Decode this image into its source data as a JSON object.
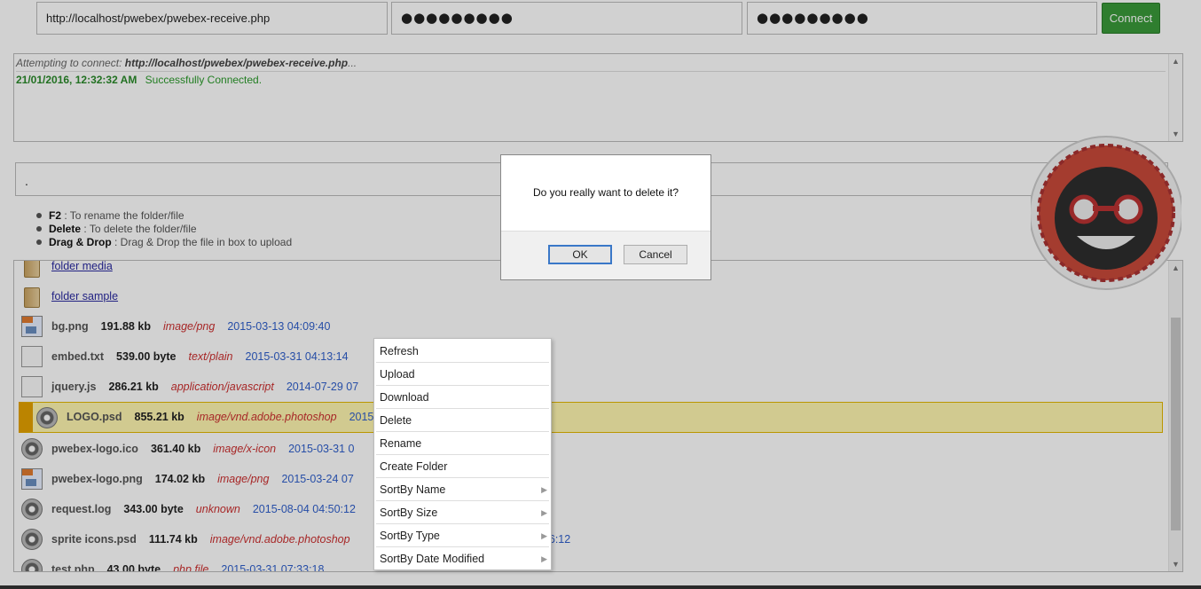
{
  "connection": {
    "url": "http://localhost/pwebex/pwebex-receive.php",
    "username_masked": "●●●●●●●●●",
    "password_masked": "●●●●●●●●●",
    "connect_label": "Connect"
  },
  "log": {
    "attempt_prefix": "Attempting to connect: ",
    "attempt_url": "http://localhost/pwebex/pwebex-receive.php",
    "attempt_suffix": "...",
    "timestamp": "21/01/2016, 12:32:32 AM",
    "status": "Successfully Connected."
  },
  "path": ".",
  "help": [
    {
      "key": "F2",
      "text": " : To rename the folder/file"
    },
    {
      "key": "Delete",
      "text": " : To delete the folder/file"
    },
    {
      "key": "Drag & Drop",
      "text": " : Drag & Drop the file in box to upload"
    }
  ],
  "folders": [
    {
      "name": "folder media"
    },
    {
      "name": "folder sample"
    }
  ],
  "files": [
    {
      "name": "bg.png",
      "size": "191.88 kb",
      "type": "image/png",
      "date": "2015-03-13 04:09:40",
      "icon": "image-icon"
    },
    {
      "name": "embed.txt",
      "size": "539.00 byte",
      "type": "text/plain",
      "date": "2015-03-31 04:13:14",
      "icon": "document-icon"
    },
    {
      "name": "jquery.js",
      "size": "286.21 kb",
      "type": "application/javascript",
      "date": "2014-07-29 07",
      "icon": "document-icon"
    },
    {
      "name": "LOGO.psd",
      "size": "855.21 kb",
      "type": "image/vnd.adobe.photoshop",
      "date": "2015-04-07 01:28",
      "icon": "gear-file-icon"
    },
    {
      "name": "pwebex-logo.ico",
      "size": "361.40 kb",
      "type": "image/x-icon",
      "date": "2015-03-31 0",
      "icon": "gear-file-icon"
    },
    {
      "name": "pwebex-logo.png",
      "size": "174.02 kb",
      "type": "image/png",
      "date": "2015-03-24 07",
      "icon": "image-icon"
    },
    {
      "name": "request.log",
      "size": "343.00 byte",
      "type": "unknown",
      "date": "2015-08-04 04:50:12",
      "icon": "gear-file-icon"
    },
    {
      "name": "sprite icons.psd",
      "size": "111.74 kb",
      "type": "image/vnd.adobe.photoshop",
      "date": "13:26:12",
      "icon": "gear-file-icon"
    },
    {
      "name": "test.php",
      "size": "43.00 byte",
      "type": "php file",
      "date": "2015-03-31 07:33:18",
      "icon": "gear-file-icon"
    }
  ],
  "context_menu": [
    {
      "label": "Refresh",
      "submenu": false
    },
    {
      "label": "Upload",
      "submenu": false
    },
    {
      "label": "Download",
      "submenu": false
    },
    {
      "label": "Delete",
      "submenu": false
    },
    {
      "label": "Rename",
      "submenu": false
    },
    {
      "label": "Create Folder",
      "submenu": false
    },
    {
      "label": "SortBy Name",
      "submenu": true
    },
    {
      "label": "SortBy Size",
      "submenu": true
    },
    {
      "label": "SortBy Type",
      "submenu": true
    },
    {
      "label": "SortBy Date Modified",
      "submenu": true
    }
  ],
  "dialog": {
    "message": "Do you really want to delete it?",
    "ok_label": "OK",
    "cancel_label": "Cancel"
  },
  "colors": {
    "connect_green": "#3a9a3a",
    "status_green": "#2a9a2a",
    "mime_red": "#cc3030",
    "date_blue": "#3060cc",
    "selected_bg": "#fff7b0",
    "selected_accent": "#e5a100"
  }
}
